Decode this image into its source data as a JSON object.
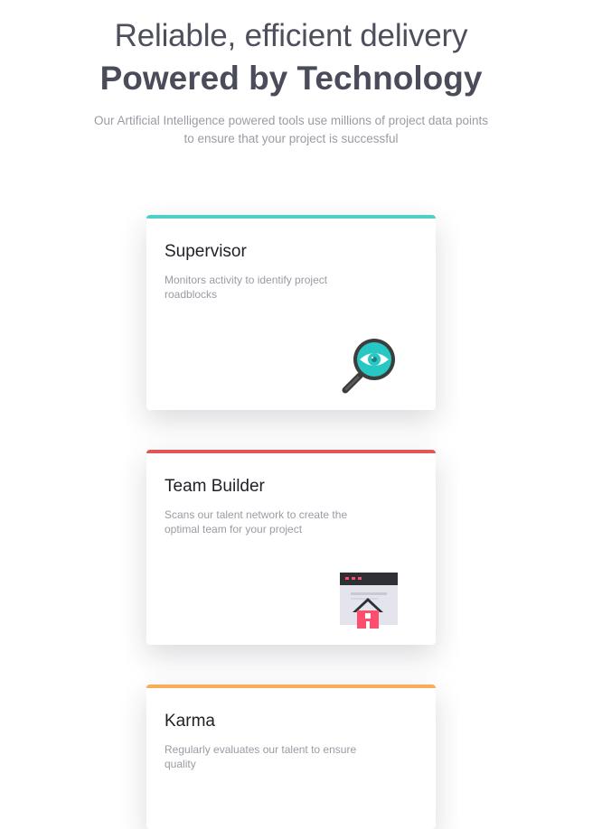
{
  "hero": {
    "line1": "Reliable, efficient delivery",
    "line2": "Powered by Technology",
    "subtitle": "Our Artificial Intelligence powered tools use millions of project data points to ensure that your project is successful"
  },
  "cards": [
    {
      "title": "Supervisor",
      "description": "Monitors activity to identify project roadblocks",
      "icon": "magnifier-eye-icon",
      "accent": "#4fcfcb"
    },
    {
      "title": "Team Builder",
      "description": "Scans our talent network to create the optimal team for your project",
      "icon": "browser-house-icon",
      "accent": "#e05757"
    },
    {
      "title": "Karma",
      "description": "Regularly evaluates our talent to ensure quality",
      "icon": "",
      "accent": "#f6ad55"
    }
  ]
}
